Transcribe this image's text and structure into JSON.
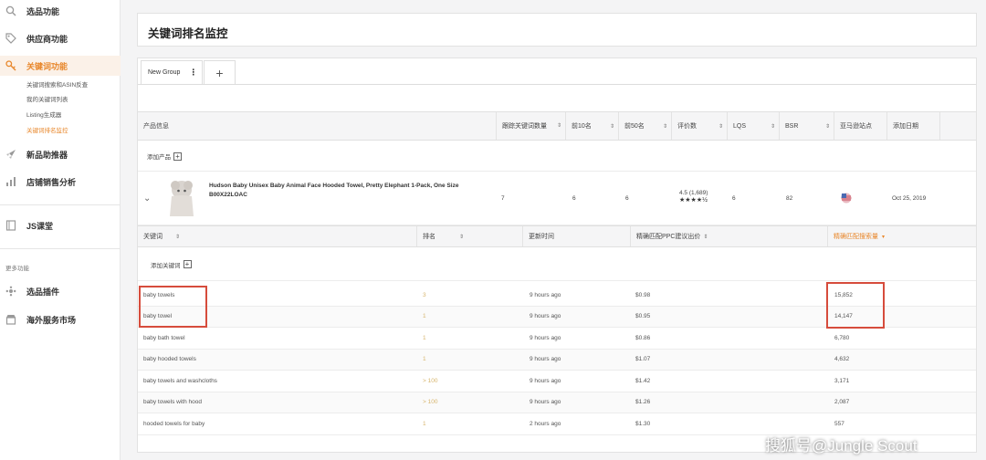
{
  "sidebar": {
    "items": [
      {
        "label": "选品功能",
        "icon": "search-icon"
      },
      {
        "label": "供应商功能",
        "icon": "tag-icon"
      },
      {
        "label": "关键词功能",
        "icon": "key-icon"
      },
      {
        "label": "新品助推器",
        "icon": "rocket-icon"
      },
      {
        "label": "店铺销售分析",
        "icon": "bar-chart-icon"
      },
      {
        "label": "JS课堂",
        "icon": "book-icon"
      },
      {
        "label": "选品插件",
        "icon": "puzzle-icon"
      },
      {
        "label": "海外服务市场",
        "icon": "storefront-icon"
      }
    ],
    "sub_items": [
      "关键词搜索和ASIN反查",
      "我的关键词列表",
      "Listing生成器",
      "关键词排名监控"
    ],
    "more_label": "更多功能"
  },
  "page": {
    "title": "关键词排名监控"
  },
  "tabs": [
    {
      "label": "New Group"
    },
    {
      "label": "+"
    }
  ],
  "product_table": {
    "headers": [
      "产品信息",
      "跟踪关键词数量",
      "前10名",
      "前50名",
      "评价数",
      "LQS",
      "BSR",
      "亚马逊站点",
      "添加日期"
    ],
    "add_product_label": "添加产品",
    "product": {
      "name": "Hudson Baby Unisex Baby Animal Face Hooded Towel, Pretty Elephant 1-Pack, One Size",
      "asin": "B00X22LOAC",
      "tracked": "7",
      "top10": "6",
      "top50": "6",
      "reviews": "4.5 (1,689)",
      "stars": "★★★★½",
      "lqs": "6",
      "bsr": "82",
      "date": "Oct 25, 2019"
    }
  },
  "keyword_table": {
    "headers": [
      "关键词",
      "排名",
      "更新时间",
      "精确匹配PPC建议出价",
      "精确匹配搜索量"
    ],
    "add_keyword_label": "添加关键词",
    "rows": [
      {
        "keyword": "baby towels",
        "rank": "3",
        "updated": "9 hours ago",
        "ppc": "$0.98",
        "volume": "15,852"
      },
      {
        "keyword": "baby towel",
        "rank": "1",
        "updated": "9 hours ago",
        "ppc": "$0.95",
        "volume": "14,147"
      },
      {
        "keyword": "baby bath towel",
        "rank": "1",
        "updated": "9 hours ago",
        "ppc": "$0.86",
        "volume": "6,780"
      },
      {
        "keyword": "baby hooded towels",
        "rank": "1",
        "updated": "9 hours ago",
        "ppc": "$1.07",
        "volume": "4,632"
      },
      {
        "keyword": "baby towels and washcloths",
        "rank": "> 100",
        "updated": "9 hours ago",
        "ppc": "$1.42",
        "volume": "3,171"
      },
      {
        "keyword": "baby towels with hood",
        "rank": "> 100",
        "updated": "9 hours ago",
        "ppc": "$1.26",
        "volume": "2,087"
      },
      {
        "keyword": "hooded towels for baby",
        "rank": "1",
        "updated": "2 hours ago",
        "ppc": "$1.30",
        "volume": "557"
      }
    ]
  },
  "watermark": "搜狐号@Jungle Scout",
  "colors": {
    "accent": "#e8872b",
    "highlight": "#d64c3c"
  }
}
